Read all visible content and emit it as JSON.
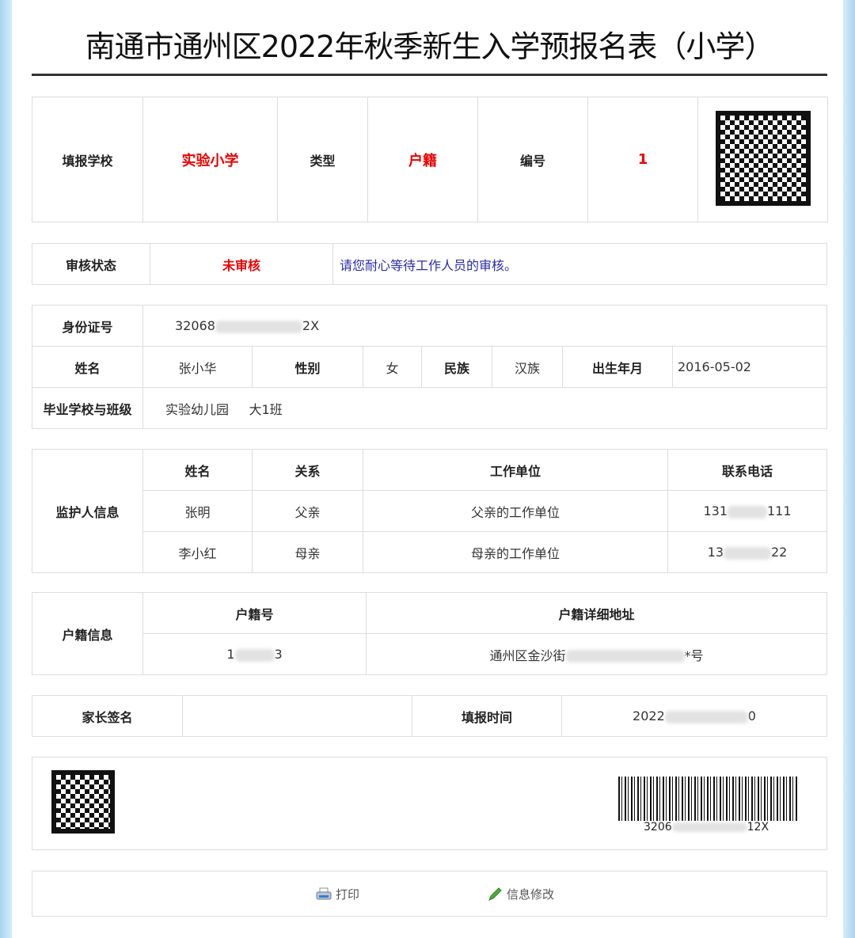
{
  "title": "南通市通州区2022年秋季新生入学预报名表（小学）",
  "header": {
    "school_label": "填报学校",
    "school": "实验小学",
    "type_label": "类型",
    "type": "户籍",
    "number_label": "编号",
    "number": "1"
  },
  "review": {
    "label": "审核状态",
    "status": "未审核",
    "message": "请您耐心等待工作人员的审核。"
  },
  "student": {
    "id_label": "身份证号",
    "id_start": "32068",
    "id_end": "2X",
    "name_label": "姓名",
    "name": "张小华",
    "gender_label": "性别",
    "gender": "女",
    "ethnicity_label": "民族",
    "ethnicity": "汉族",
    "birth_label": "出生年月",
    "birth": "2016-05-02",
    "grad_label": "毕业学校与班级",
    "grad_school": "实验幼儿园",
    "grad_class": "大1班"
  },
  "guardian": {
    "label": "监护人信息",
    "headers": [
      "姓名",
      "关系",
      "工作单位",
      "联系电话"
    ],
    "rows": [
      {
        "name": "张明",
        "relation": "父亲",
        "work": "父亲的工作单位",
        "phone_start": "131",
        "phone_end": "111"
      },
      {
        "name": "李小红",
        "relation": "母亲",
        "work": "母亲的工作单位",
        "phone_start": "13",
        "phone_end": "22"
      }
    ]
  },
  "household": {
    "label": "户籍信息",
    "headers": [
      "户籍号",
      "户籍详细地址"
    ],
    "no_start": "1",
    "no_end": "3",
    "address_start": "通州区金沙街",
    "address_end": "*号"
  },
  "sign": {
    "label": "家长签名",
    "value": "",
    "time_label": "填报时间",
    "time_start": "2022",
    "time_end": "0"
  },
  "barcode": {
    "start": "3206",
    "end": "12X"
  },
  "actions": {
    "print": "打印",
    "edit": "信息修改"
  }
}
